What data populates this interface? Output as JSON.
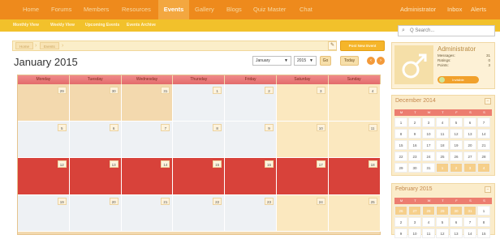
{
  "topnav": {
    "items": [
      "Home",
      "Forums",
      "Members",
      "Resources",
      "Events",
      "Gallery",
      "Blogs",
      "Quiz Master",
      "Chat"
    ],
    "active": "Events",
    "right": [
      "Administrator",
      "Inbox",
      "Alerts"
    ]
  },
  "subnav": {
    "items": [
      "Monthly View",
      "Weekly View",
      "Upcoming Events",
      "Events Archive"
    ]
  },
  "breadcrumb": [
    "Home",
    "Events"
  ],
  "post_button": "Post New Event",
  "calendar": {
    "title": "January 2015",
    "month_select": "January",
    "year_select": "2015",
    "go_label": "Go",
    "today_label": "Today",
    "prev": "‹",
    "next": "›",
    "days": [
      "Monday",
      "Tuesday",
      "Wednesday",
      "Thursday",
      "Friday",
      "Saturday",
      "Sunday"
    ],
    "weeks": [
      [
        {
          "n": "29",
          "kind": "other"
        },
        {
          "n": "30",
          "kind": "other"
        },
        {
          "n": "31",
          "kind": "other"
        },
        {
          "n": "1",
          "kind": "weekday"
        },
        {
          "n": "2",
          "kind": "weekday"
        },
        {
          "n": "3",
          "kind": "weekend"
        },
        {
          "n": "4",
          "kind": "weekend"
        }
      ],
      [
        {
          "n": "5",
          "kind": "weekday"
        },
        {
          "n": "6",
          "kind": "weekday"
        },
        {
          "n": "7",
          "kind": "weekday"
        },
        {
          "n": "8",
          "kind": "weekday"
        },
        {
          "n": "9",
          "kind": "weekday"
        },
        {
          "n": "10",
          "kind": "weekend"
        },
        {
          "n": "11",
          "kind": "weekend"
        }
      ],
      [
        {
          "n": "12",
          "kind": "current"
        },
        {
          "n": "13",
          "kind": "current"
        },
        {
          "n": "14",
          "kind": "current"
        },
        {
          "n": "15",
          "kind": "current"
        },
        {
          "n": "16",
          "kind": "current"
        },
        {
          "n": "17",
          "kind": "current"
        },
        {
          "n": "18",
          "kind": "current"
        }
      ],
      [
        {
          "n": "19",
          "kind": "weekday"
        },
        {
          "n": "20",
          "kind": "weekday"
        },
        {
          "n": "21",
          "kind": "weekday"
        },
        {
          "n": "22",
          "kind": "weekday"
        },
        {
          "n": "23",
          "kind": "weekday"
        },
        {
          "n": "24",
          "kind": "weekend"
        },
        {
          "n": "25",
          "kind": "weekend"
        }
      ]
    ],
    "colors": {
      "other": "#f3d9ae",
      "weekday": "#eef1f4",
      "weekend": "#fbe8bf",
      "current": "#d8423a"
    }
  },
  "sidebar": {
    "search_placeholder": "Q Search...",
    "profile": {
      "name": "Administrator",
      "stats": [
        {
          "label": "Messages:",
          "value": "31"
        },
        {
          "label": "Ratings:",
          "value": "0"
        },
        {
          "label": "Points:",
          "value": "3"
        }
      ],
      "toggle_label": "Invisible"
    },
    "mini_calendars": [
      {
        "title": "December 2014",
        "head": [
          "M",
          "T",
          "W",
          "T",
          "F",
          "S",
          "S"
        ],
        "rows": [
          [
            {
              "n": "1"
            },
            {
              "n": "2"
            },
            {
              "n": "3"
            },
            {
              "n": "4"
            },
            {
              "n": "5"
            },
            {
              "n": "6"
            },
            {
              "n": "7"
            }
          ],
          [
            {
              "n": "8"
            },
            {
              "n": "9"
            },
            {
              "n": "10"
            },
            {
              "n": "11"
            },
            {
              "n": "12"
            },
            {
              "n": "13"
            },
            {
              "n": "14"
            }
          ],
          [
            {
              "n": "15"
            },
            {
              "n": "16"
            },
            {
              "n": "17"
            },
            {
              "n": "18"
            },
            {
              "n": "19"
            },
            {
              "n": "20"
            },
            {
              "n": "21"
            }
          ],
          [
            {
              "n": "22"
            },
            {
              "n": "23"
            },
            {
              "n": "24"
            },
            {
              "n": "25"
            },
            {
              "n": "26"
            },
            {
              "n": "27"
            },
            {
              "n": "28"
            }
          ],
          [
            {
              "n": "29"
            },
            {
              "n": "30"
            },
            {
              "n": "31"
            },
            {
              "n": "1",
              "o": true
            },
            {
              "n": "2",
              "o": true
            },
            {
              "n": "3",
              "o": true
            },
            {
              "n": "4",
              "o": true
            }
          ]
        ]
      },
      {
        "title": "February 2015",
        "head": [
          "M",
          "T",
          "W",
          "T",
          "F",
          "S",
          "S"
        ],
        "rows": [
          [
            {
              "n": "26",
              "o": true
            },
            {
              "n": "27",
              "o": true
            },
            {
              "n": "28",
              "o": true
            },
            {
              "n": "29",
              "o": true
            },
            {
              "n": "30",
              "o": true
            },
            {
              "n": "31",
              "o": true
            },
            {
              "n": "1"
            }
          ],
          [
            {
              "n": "2"
            },
            {
              "n": "3"
            },
            {
              "n": "4"
            },
            {
              "n": "5"
            },
            {
              "n": "6"
            },
            {
              "n": "7"
            },
            {
              "n": "8"
            }
          ],
          [
            {
              "n": "9"
            },
            {
              "n": "10"
            },
            {
              "n": "11"
            },
            {
              "n": "12"
            },
            {
              "n": "13"
            },
            {
              "n": "14"
            },
            {
              "n": "15"
            }
          ]
        ]
      }
    ]
  }
}
